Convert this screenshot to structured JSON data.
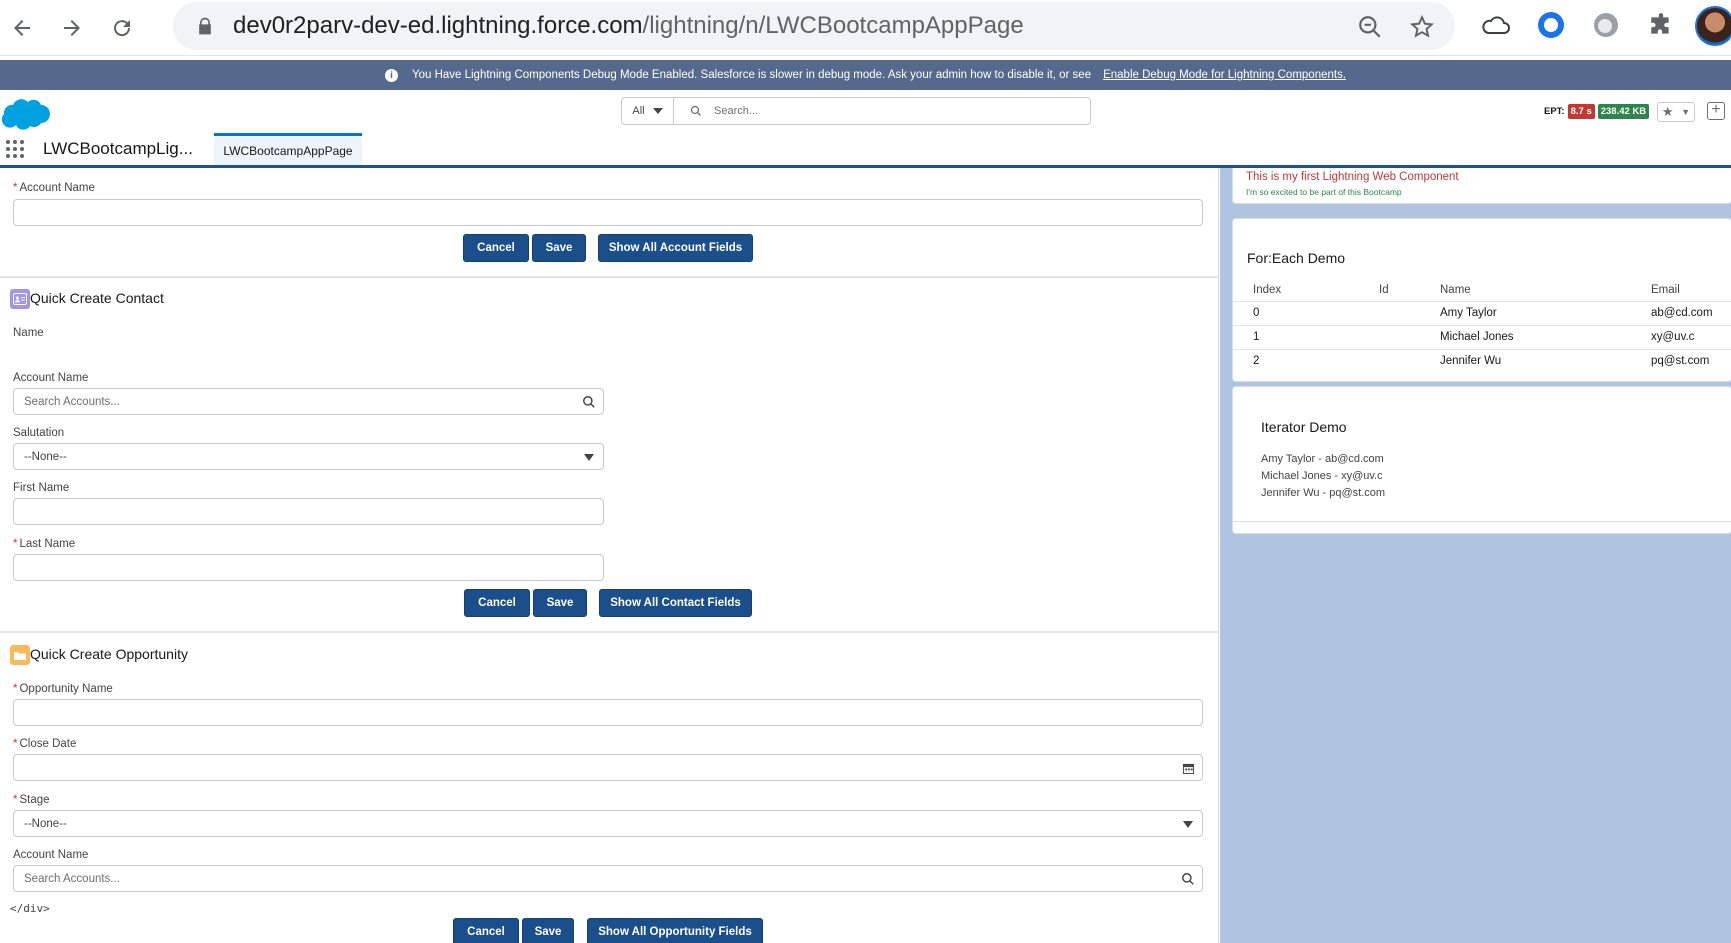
{
  "browser": {
    "url_host": "dev0r2parv-dev-ed.lightning.force.com",
    "url_path": "/lightning/n/LWCBootcampAppPage"
  },
  "debug_banner": {
    "message": "You Have Lightning Components Debug Mode Enabled. Salesforce is slower in debug mode. Ask your admin how to disable it, or see",
    "link_text": "Enable Debug Mode for Lightning Components."
  },
  "global_header": {
    "search_scope": "All",
    "search_placeholder": "Search...",
    "ept_label": "EPT:",
    "ept_time": "8.7 s",
    "ept_size": "238.42 KB"
  },
  "app_nav": {
    "app_name": "LWCBootcampLig...",
    "tab_label": "LWCBootcampAppPage"
  },
  "account_section": {
    "account_name_label": "Account Name",
    "cancel_label": "Cancel",
    "save_label": "Save",
    "show_all_label": "Show All Account Fields"
  },
  "contact_section": {
    "title": "Quick Create Contact",
    "name_label": "Name",
    "account_name_label": "Account Name",
    "account_placeholder": "Search Accounts...",
    "salutation_label": "Salutation",
    "salutation_value": "--None--",
    "first_name_label": "First Name",
    "last_name_label": "Last Name",
    "cancel_label": "Cancel",
    "save_label": "Save",
    "show_all_label": "Show All Contact Fields"
  },
  "opportunity_section": {
    "title": "Quick Create Opportunity",
    "opportunity_name_label": "Opportunity Name",
    "close_date_label": "Close Date",
    "stage_label": "Stage",
    "stage_value": "--None--",
    "account_name_label": "Account Name",
    "account_placeholder": "Search Accounts...",
    "raw_text": "</div>",
    "cancel_label": "Cancel",
    "save_label": "Save",
    "show_all_label": "Show All Opportunity Fields"
  },
  "hello_card": {
    "line1": "This is my first Lightning Web Component",
    "line2": "I'm so excited to be part of this Bootcamp"
  },
  "foreach_demo": {
    "title": "For:Each Demo",
    "columns": [
      "Index",
      "Id",
      "Name",
      "Email"
    ],
    "rows": [
      {
        "index": "0",
        "id": "",
        "name": "Amy Taylor",
        "email": "ab@cd.com"
      },
      {
        "index": "1",
        "id": "",
        "name": "Michael Jones",
        "email": "xy@uv.c"
      },
      {
        "index": "2",
        "id": "",
        "name": "Jennifer Wu",
        "email": "pq@st.com"
      }
    ]
  },
  "iterator_demo": {
    "title": "Iterator Demo",
    "items": [
      "Amy Taylor - ab@cd.com",
      "Michael Jones - xy@uv.c",
      "Jennifer Wu - pq@st.com"
    ]
  },
  "colors": {
    "banner": "#55698c",
    "brand_button": "#1b4f8c",
    "ept_time_badge": "#c23934",
    "ept_size_badge": "#2e844a",
    "right_background": "#b0c4df"
  },
  "icons": [
    "back-icon",
    "forward-icon",
    "reload-icon",
    "lock-icon",
    "zoom-out-icon",
    "star-icon",
    "cloud-icon",
    "extension-icon",
    "puzzle-icon",
    "salesforce-logo",
    "search-icon",
    "waffle-icon",
    "contact-icon",
    "opportunity-icon",
    "calendar-icon",
    "info-icon"
  ]
}
